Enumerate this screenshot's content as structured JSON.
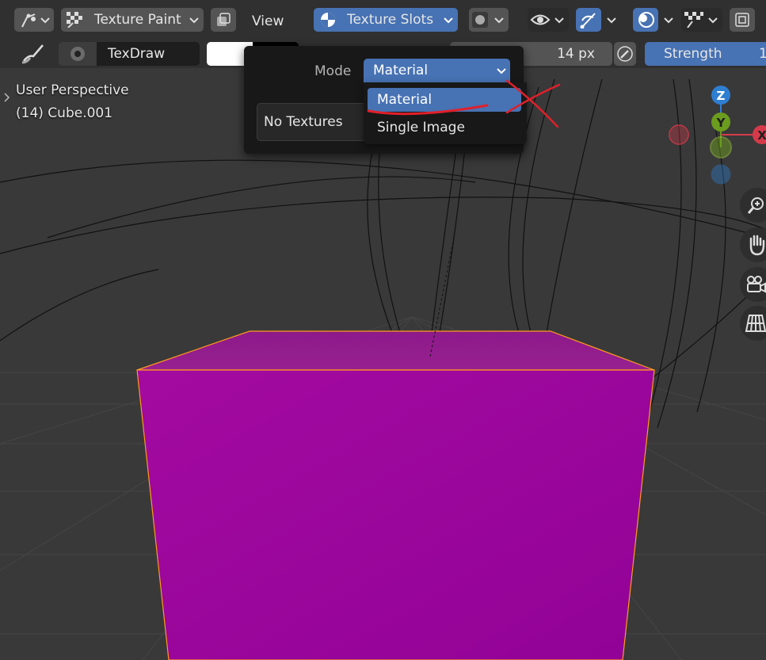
{
  "header": {
    "mode_label": "Texture Paint",
    "view_menu": "View",
    "texture_slots_label": "Texture Slots"
  },
  "toolbar": {
    "brush_name": "TexDraw",
    "radius_value": "14 px",
    "strength_label": "Strength",
    "strength_value_partial": "1"
  },
  "viewport": {
    "perspective_label": "User Perspective",
    "object_label": "(14) Cube.001",
    "gizmo_axes": [
      "X",
      "Y",
      "Z"
    ]
  },
  "popover": {
    "mode_label": "Mode",
    "mode_value": "Material",
    "no_textures": "No Textures"
  },
  "dropdown": {
    "options": [
      "Material",
      "Single Image"
    ],
    "selected": "Material"
  },
  "colors": {
    "accent": "#4772b3",
    "cube_face": "#9a0699",
    "cube_edge": "#ff9a1a",
    "annotation": "#e0202a",
    "axis_x": "#d63a4a",
    "axis_y": "#6b9c1e",
    "axis_z": "#2e7ed1"
  },
  "icons": {
    "editor_type": "paint-brush-editor-icon",
    "mode": "texture-paint-checker-icon",
    "slots": "texture-slots-pie-icon",
    "visibility": "eye-icon",
    "gizmo": "gizmo-toggle-icon",
    "overlay": "overlay-icon",
    "shading": "shading-checker-icon",
    "zoom": "zoom-icon",
    "pan": "hand-pan-icon",
    "camera": "camera-icon",
    "ortho": "ortho-grid-icon"
  }
}
